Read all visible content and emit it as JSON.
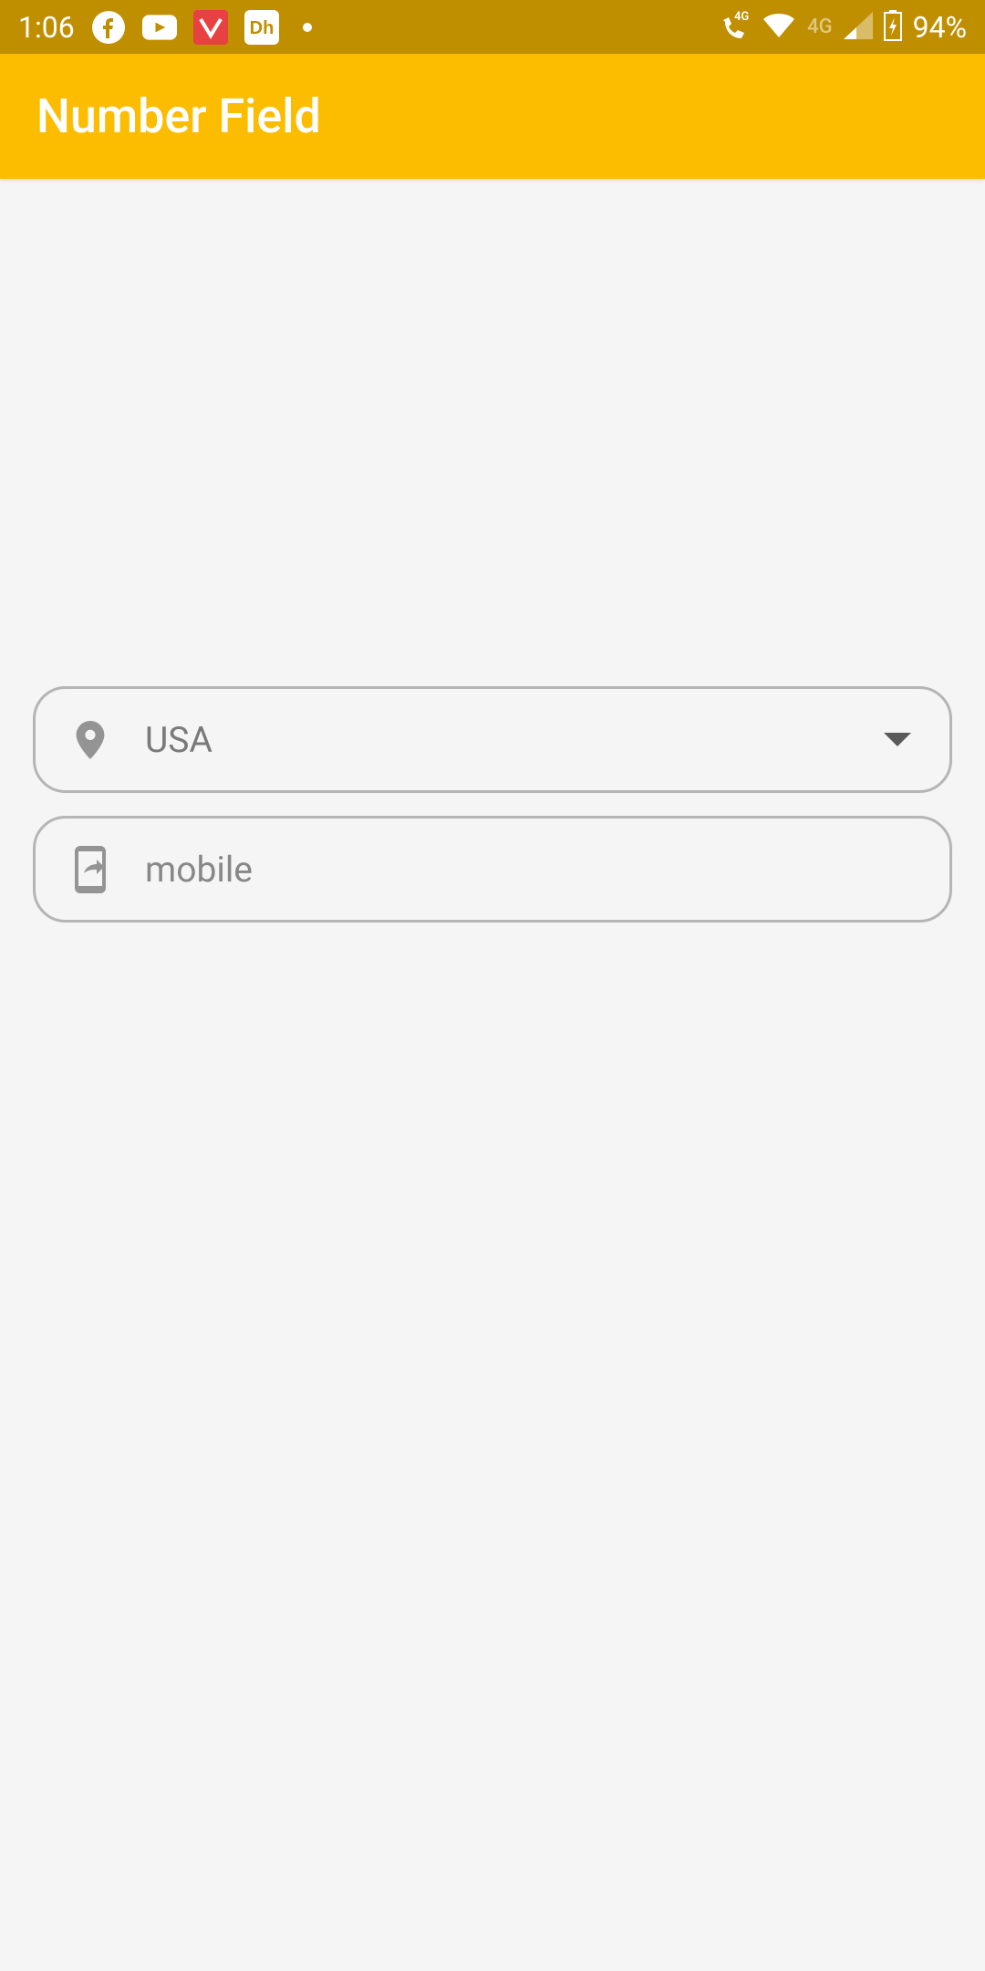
{
  "status_bar": {
    "time": "1:06",
    "battery_percent": "94%",
    "network_label": "4G"
  },
  "app_bar": {
    "title": "Number Field"
  },
  "fields": {
    "country": {
      "value": "USA"
    },
    "mobile": {
      "placeholder": "mobile"
    }
  }
}
